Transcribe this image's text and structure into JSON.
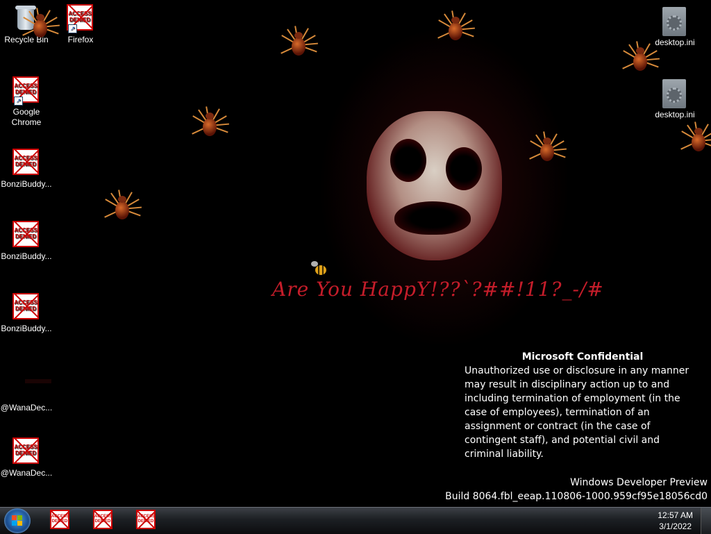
{
  "desktop": {
    "icons": [
      {
        "label": "Recycle Bin",
        "kind": "recycle-bin"
      },
      {
        "label": "Firefox",
        "kind": "access-denied-shortcut"
      },
      {
        "label": "Google Chrome",
        "kind": "access-denied-shortcut"
      },
      {
        "label": "BonziBuddy...",
        "kind": "access-denied"
      },
      {
        "label": "BonziBuddy...",
        "kind": "access-denied"
      },
      {
        "label": "BonziBuddy...",
        "kind": "access-denied"
      },
      {
        "label": "@WanaDec...",
        "kind": "blank"
      },
      {
        "label": "@WanaDec...",
        "kind": "access-denied"
      },
      {
        "label": "desktop.ini",
        "kind": "settings-file"
      },
      {
        "label": "desktop.ini",
        "kind": "settings-file"
      }
    ],
    "access_denied_text": "ACCESS DENIED",
    "wallpaper_text": "Are You HappY!??`?##!11?_-/#",
    "watermark": {
      "title": "Microsoft Confidential",
      "body": "Unauthorized use or disclosure in any manner may result in disciplinary action up to and including termination of employment (in the case of employees), termination of an assignment or contract (in the case of contingent staff), and potential civil and criminal liability.",
      "edition": "Windows Developer Preview",
      "build": "Build 8064.fbl_eeap.110806-1000.959cf95e18056cd0"
    }
  },
  "taskbar": {
    "start_icon": "windows-start-orb",
    "pinned": [
      "access-denied",
      "access-denied",
      "access-denied"
    ],
    "clock": {
      "time": "12:57 AM",
      "date": "3/1/2022"
    }
  },
  "colors": {
    "wallpaper_text": "#c51d2a",
    "taskbar": "#1c1f23",
    "denied_red": "#cc0000"
  }
}
